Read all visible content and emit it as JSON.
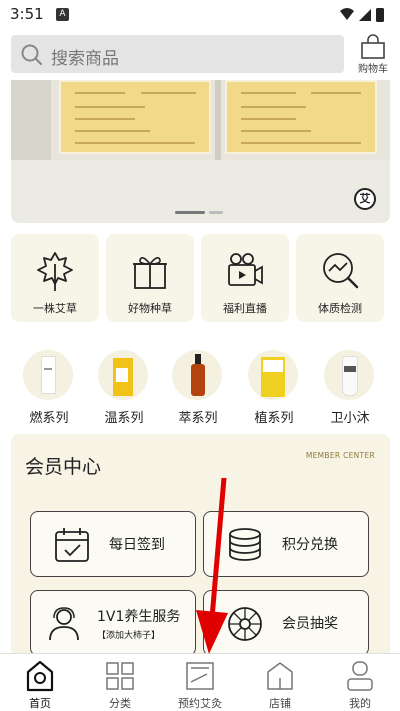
{
  "status_bar": {
    "time": "3:51",
    "notification_icon": "A"
  },
  "search": {
    "placeholder": "搜索商品"
  },
  "cart": {
    "label": "购物车"
  },
  "banner": {
    "badge": "艾"
  },
  "features": [
    {
      "label": "一株艾草",
      "icon": "leaf-icon"
    },
    {
      "label": "好物种草",
      "icon": "gift-icon"
    },
    {
      "label": "福利直播",
      "icon": "video-camera-icon"
    },
    {
      "label": "体质检测",
      "icon": "chart-search-icon"
    }
  ],
  "series": [
    {
      "label": "燃系列"
    },
    {
      "label": "温系列"
    },
    {
      "label": "萃系列"
    },
    {
      "label": "植系列"
    },
    {
      "label": "卫小沐"
    }
  ],
  "member_center": {
    "title": "会员中心",
    "subtitle": "MEMBER CENTER",
    "actions": [
      {
        "label": "每日签到",
        "icon": "calendar-check-icon"
      },
      {
        "label": "积分兑换",
        "icon": "coins-icon"
      },
      {
        "label": "1V1养生服务",
        "sub": "【添加大柿子】",
        "icon": "user-service-icon"
      },
      {
        "label": "会员抽奖",
        "icon": "lottery-wheel-icon"
      }
    ]
  },
  "tabbar": [
    {
      "label": "首页",
      "icon": "home-icon",
      "active": true
    },
    {
      "label": "分类",
      "icon": "grid-icon"
    },
    {
      "label": "预约艾灸",
      "icon": "booking-icon"
    },
    {
      "label": "店铺",
      "icon": "store-icon"
    },
    {
      "label": "我的",
      "icon": "profile-icon"
    }
  ],
  "colors": {
    "card_bg": "#f7f4e8",
    "accent_gold": "#8b7a3a",
    "arrow": "#e00000"
  }
}
